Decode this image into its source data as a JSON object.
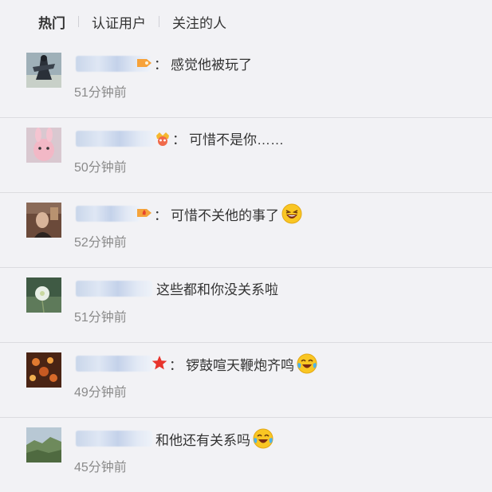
{
  "tabs": [
    {
      "label": "热门",
      "active": true
    },
    {
      "label": "认证用户",
      "active": false
    },
    {
      "label": "关注的人",
      "active": false
    }
  ],
  "comments": [
    {
      "text": "感觉他被玩了",
      "time": "51分钟前",
      "badge": "orange-tag-icon",
      "emoji": null
    },
    {
      "text": "可惜不是你……",
      "time": "50分钟前",
      "badge": "crown-heart-icon",
      "emoji": null
    },
    {
      "text": "可惜不关他的事了",
      "time": "52分钟前",
      "badge": "fire-tag-icon",
      "emoji": "laughing-emoji-icon"
    },
    {
      "text": "这些都和你没关系啦",
      "time": "51分钟前",
      "badge": null,
      "emoji": null
    },
    {
      "text": "锣鼓喧天鞭炮齐鸣",
      "time": "49分钟前",
      "badge": "red-star-icon",
      "emoji": "crying-laughing-emoji-icon"
    },
    {
      "text": "和他还有关系吗",
      "time": "45分钟前",
      "badge": null,
      "emoji": "crying-laughing-emoji-icon"
    }
  ],
  "colons": [
    "：",
    "：",
    "：",
    "",
    "：",
    ""
  ]
}
